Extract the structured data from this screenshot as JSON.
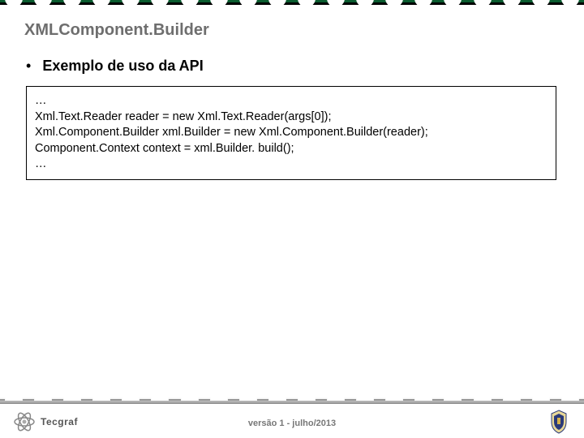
{
  "title": "XMLComponent.Builder",
  "bullet": "•",
  "bullet_text": "Exemplo de uso da API",
  "code": {
    "l0": "…",
    "l1": "Xml.Text.Reader reader = new Xml.Text.Reader(args[0]);",
    "l2": "Xml.Component.Builder xml.Builder = new Xml.Component.Builder(reader);",
    "l3": "Component.Context context = xml.Builder. build();",
    "l4": "…"
  },
  "footer": {
    "left_logo_text": "Tecgraf",
    "center": "versão 1 - julho/2013"
  }
}
